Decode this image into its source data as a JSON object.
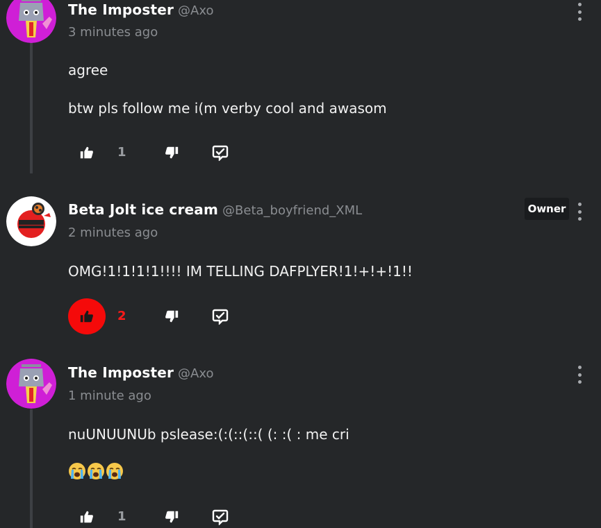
{
  "colors": {
    "background": "#252729",
    "like_active": "#f50a0a",
    "muted_text": "#8a8d91",
    "owner_badge_bg": "#1a1c1e"
  },
  "comments": [
    {
      "author_name": "The Imposter",
      "author_handle": "@Axo",
      "timestamp": "3 minutes ago",
      "body": [
        "agree",
        "btw pls follow me i(m verby cool and awasom"
      ],
      "like_count": "1",
      "liked": false,
      "avatar": "imposter-avatar"
    },
    {
      "author_name": "Beta Jolt ice cream",
      "author_handle": "@Beta_boyfriend_XML",
      "timestamp": "2 minutes ago",
      "badge": "Owner",
      "body": [
        "OMG!1!1!1!1!!!! IM TELLING DAFPLYER!1!+!+!1!!"
      ],
      "like_count": "2",
      "liked": true,
      "avatar": "beta-avatar"
    },
    {
      "author_name": "The Imposter",
      "author_handle": "@Axo",
      "timestamp": "1 minute ago",
      "body": [
        "nuUNUUNUb pslease:(:(::(::( (: :( : me cri"
      ],
      "emojis": [
        "loudly-crying-face-emoji",
        "loudly-crying-face-emoji",
        "loudly-crying-face-emoji"
      ],
      "like_count": "1",
      "liked": false,
      "avatar": "imposter-avatar"
    }
  ]
}
